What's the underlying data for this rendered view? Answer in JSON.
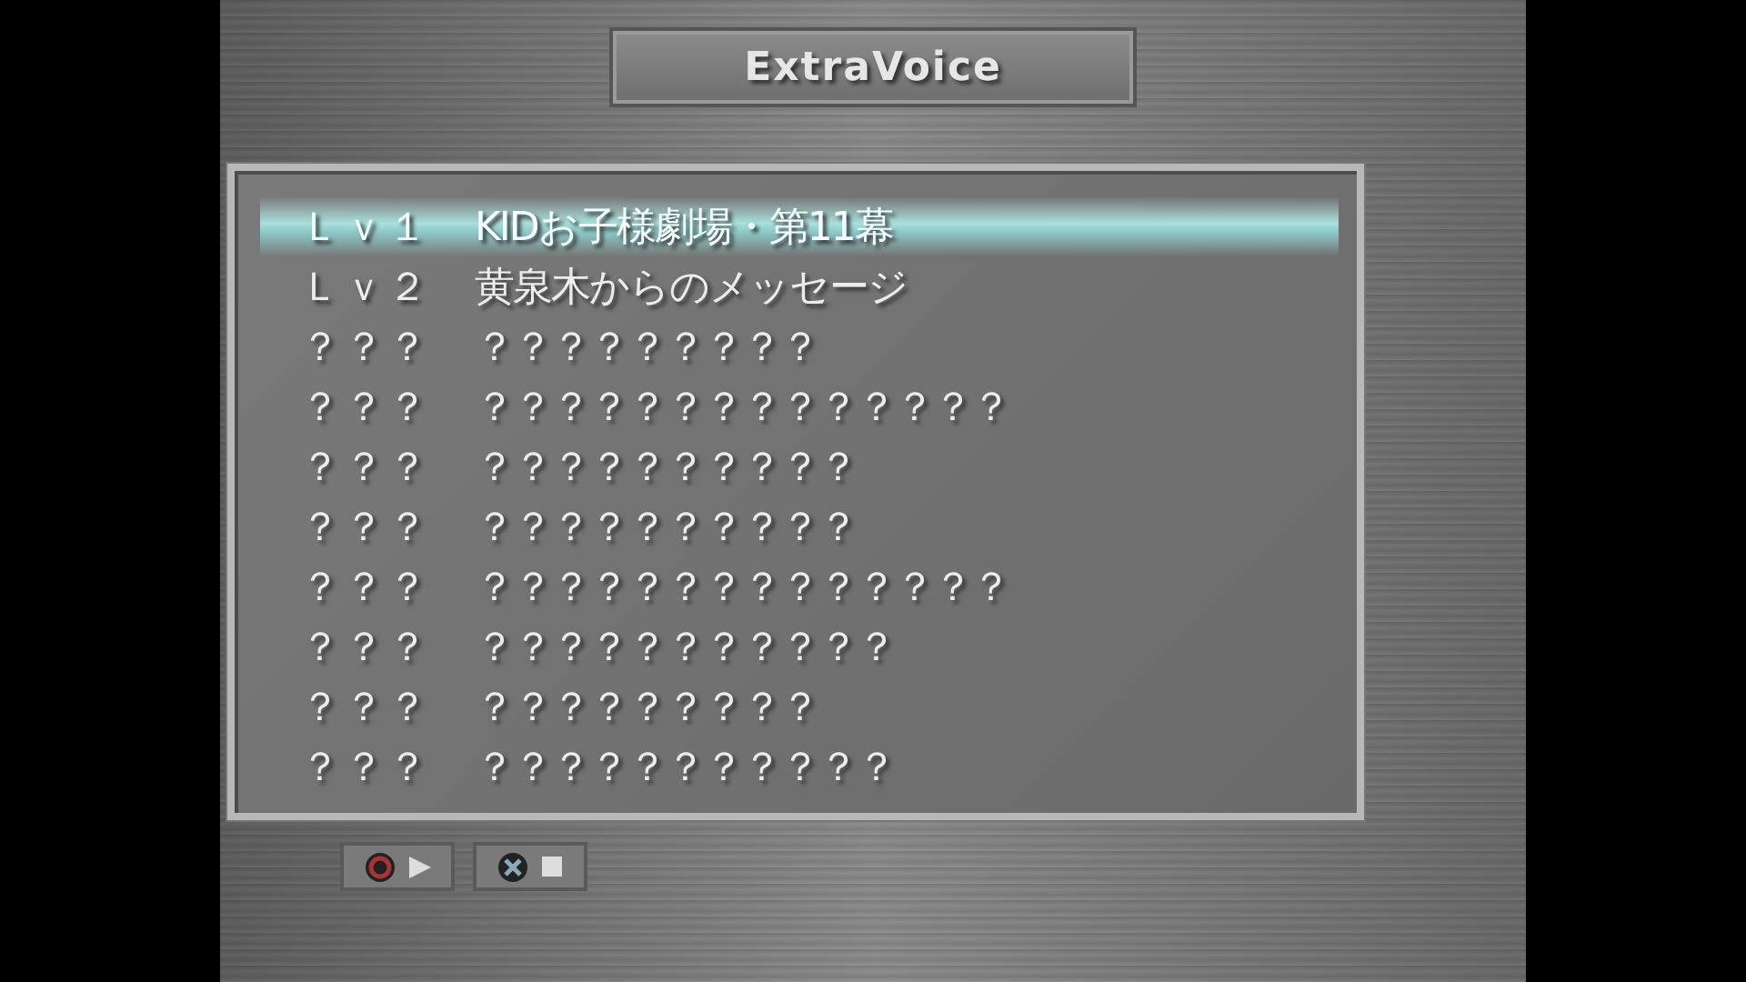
{
  "title": "ExtraVoice",
  "items": [
    {
      "level": "Ｌｖ１",
      "name": "KIDお子様劇場・第11幕",
      "selected": true
    },
    {
      "level": "Ｌｖ２",
      "name": "黄泉木からのメッセージ",
      "selected": false
    },
    {
      "level": "？？？",
      "name": "？？？？？？？？？",
      "selected": false
    },
    {
      "level": "？？？",
      "name": "？？？？？？？？？？？？？？",
      "selected": false
    },
    {
      "level": "？？？",
      "name": "？？？？？？？？？？",
      "selected": false
    },
    {
      "level": "？？？",
      "name": "？？？？？？？？？？",
      "selected": false
    },
    {
      "level": "？？？",
      "name": "？？？？？？？？？？？？？？",
      "selected": false
    },
    {
      "level": "？？？",
      "name": "？？？？？？？？？？？",
      "selected": false
    },
    {
      "level": "？？？",
      "name": "？？？？？？？？？",
      "selected": false
    },
    {
      "level": "？？？",
      "name": "？？？？？？？？？？？",
      "selected": false
    }
  ],
  "buttons": [
    {
      "kind": "play"
    },
    {
      "kind": "stop"
    }
  ]
}
